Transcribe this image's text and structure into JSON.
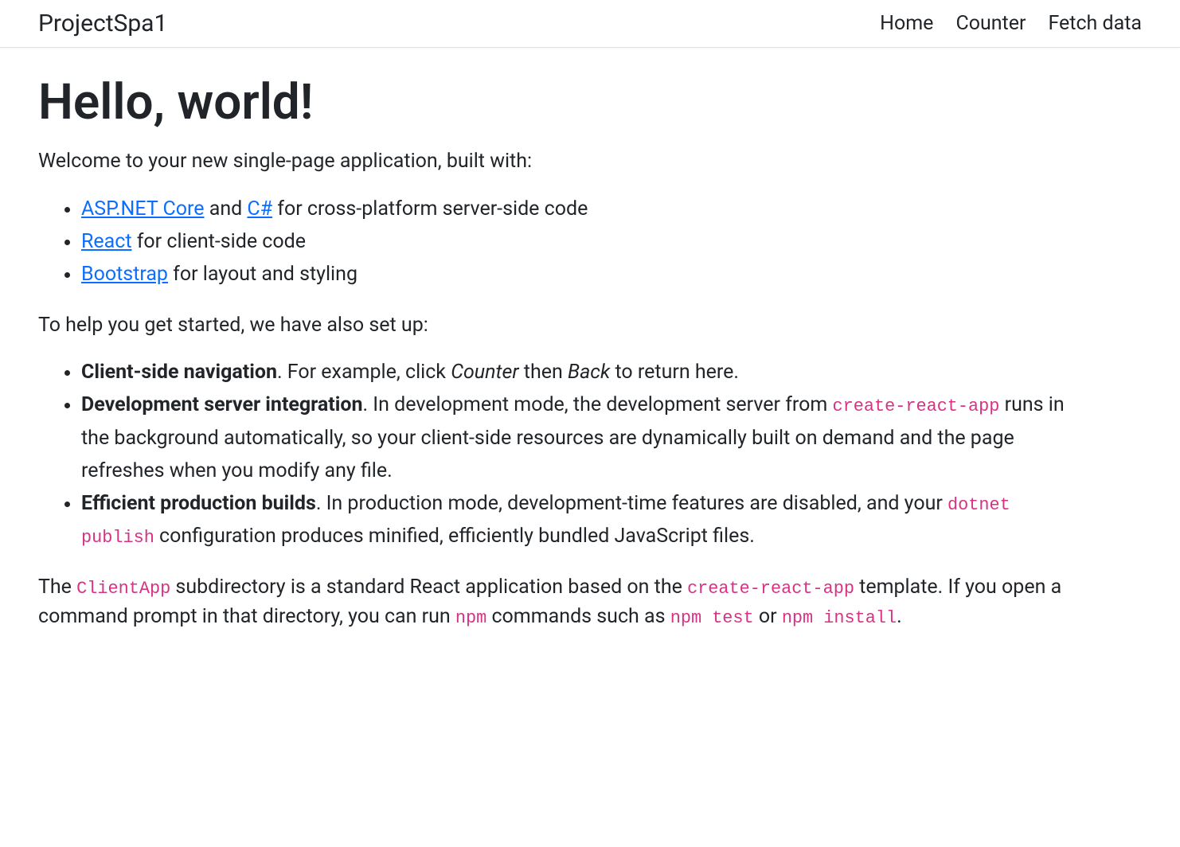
{
  "navbar": {
    "brand": "ProjectSpa1",
    "links": [
      {
        "label": "Home"
      },
      {
        "label": "Counter"
      },
      {
        "label": "Fetch data"
      }
    ]
  },
  "heading": "Hello, world!",
  "intro_paragraph": "Welcome to your new single-page application, built with:",
  "tech_list": [
    {
      "link1": "ASP.NET Core",
      "mid1": " and ",
      "link2": "C#",
      "suffix": " for cross-platform server-side code"
    },
    {
      "link1": "React",
      "suffix": " for client-side code"
    },
    {
      "link1": "Bootstrap",
      "suffix": " for layout and styling"
    }
  ],
  "subheading": "To help you get started, we have also set up:",
  "features": [
    {
      "strong": "Client-side navigation",
      "after_strong": ". For example, click ",
      "em1": "Counter",
      "mid": " then ",
      "em2": "Back",
      "tail": " to return here."
    },
    {
      "strong": "Development server integration",
      "after_strong": ". In development mode, the development server from ",
      "code1": "create-react-app",
      "tail": " runs in the background automatically, so your client-side resources are dynamically built on demand and the page refreshes when you modify any file."
    },
    {
      "strong": "Efficient production builds",
      "after_strong": ". In production mode, development-time features are disabled, and your ",
      "code1": "dotnet publish",
      "tail": " configuration produces minified, efficiently bundled JavaScript files."
    }
  ],
  "closing": {
    "t1": "The ",
    "code1": "ClientApp",
    "t2": " subdirectory is a standard React application based on the ",
    "code2": "create-react-app",
    "t3": " template. If you open a command prompt in that directory, you can run ",
    "code3": "npm",
    "t4": " commands such as ",
    "code4": "npm test",
    "t5": " or ",
    "code5": "npm install",
    "t6": "."
  }
}
